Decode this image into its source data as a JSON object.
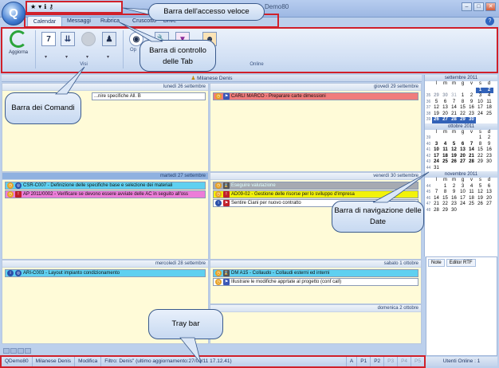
{
  "window": {
    "title_fragment": "Demo80"
  },
  "quick_access": {
    "icons": [
      "star-icon",
      "info-icon",
      "key-icon"
    ]
  },
  "tabs": [
    {
      "label": "Calendar",
      "active": true
    },
    {
      "label": "Messaggi"
    },
    {
      "label": "Rubrica"
    },
    {
      "label": "Cruscotto"
    },
    {
      "label": "Drive"
    }
  ],
  "ribbon": {
    "refresh_label": "Aggiorna",
    "group_online": "Online",
    "group_vis_fragment": "Visi",
    "group_op_fragment": "Op"
  },
  "owner_header": "Milanese Denis",
  "days": [
    {
      "label": "lunedì 26 settembre",
      "events": [
        {
          "text": "...nire specifiche All. B",
          "color": "#ffffff"
        }
      ]
    },
    {
      "label": "giovedì 29 settembre",
      "events": [
        {
          "text": "CARLI MARCO - Preparare carte dimessioni",
          "color": "#f07c7c"
        }
      ]
    },
    {
      "label": "martedì 27 settembre",
      "events": [
        {
          "text": "CSR-C007 - Definizione delle specifiche base e selezione dei materiali",
          "color": "#5fd0f0"
        },
        {
          "text": "AP 2011/0002 - Verificare se devono essere avviate delle AC in seguito all'oss",
          "color": "#ec7dd8"
        }
      ]
    },
    {
      "label": "venerdì 30 settembre",
      "events": [
        {
          "text": "Eseguire valutazione",
          "color": "#a6aab2"
        },
        {
          "text": "AD09-02 - Gestione delle risorse per lo sviluppo d'impresa",
          "color": "#f2f20a"
        },
        {
          "text": "Sentire Ciani per nuovo contratto",
          "color": "#ffffff"
        }
      ]
    },
    {
      "label": "mercoledì 28 settembre",
      "events": [
        {
          "text": "ARI-C003 - Layout impianto condizionamento",
          "color": "#5fd0f0"
        }
      ]
    },
    {
      "label": "sabato 1 ottobre",
      "events": [
        {
          "text": "DM A15 - Collaudo - Collaudi esterni ed interni",
          "color": "#5fd0f0"
        },
        {
          "text": "Illustrare le modifiche apprtate al progetto (conf call)",
          "color": "#ffffff"
        }
      ]
    },
    {
      "label": "domenica 2 ottobre",
      "events": []
    }
  ],
  "calendars": [
    {
      "title": "settembre 2011",
      "weekdays": [
        "l",
        "m",
        "m",
        "g",
        "v",
        "s",
        "d"
      ],
      "rows": [
        {
          "wk": "",
          "days": [
            "",
            "",
            "",
            "",
            "",
            "1",
            "2"
          ]
        },
        {
          "wk": "35",
          "days": [
            "29",
            "30",
            "31",
            "1",
            "2",
            "3",
            "4"
          ]
        },
        {
          "wk": "36",
          "days": [
            "5",
            "6",
            "7",
            "8",
            "9",
            "10",
            "11"
          ]
        },
        {
          "wk": "37",
          "days": [
            "12",
            "13",
            "14",
            "15",
            "16",
            "17",
            "18"
          ]
        },
        {
          "wk": "38",
          "days": [
            "19",
            "20",
            "21",
            "22",
            "23",
            "24",
            "25"
          ]
        },
        {
          "wk": "39",
          "days": [
            "26",
            "27",
            "28",
            "29",
            "30",
            "",
            ""
          ]
        }
      ]
    },
    {
      "title": "ottobre 2011",
      "weekdays": [
        "l",
        "m",
        "m",
        "g",
        "v",
        "s",
        "d"
      ],
      "rows": [
        {
          "wk": "39",
          "days": [
            "",
            "",
            "",
            "",
            "",
            "1",
            "2"
          ]
        },
        {
          "wk": "40",
          "days": [
            "3",
            "4",
            "5",
            "6",
            "7",
            "8",
            "9"
          ]
        },
        {
          "wk": "41",
          "days": [
            "10",
            "11",
            "12",
            "13",
            "14",
            "15",
            "16"
          ]
        },
        {
          "wk": "42",
          "days": [
            "17",
            "18",
            "19",
            "20",
            "21",
            "22",
            "23"
          ]
        },
        {
          "wk": "43",
          "days": [
            "24",
            "25",
            "26",
            "27",
            "28",
            "29",
            "30"
          ]
        },
        {
          "wk": "44",
          "days": [
            "31",
            "",
            "",
            "",
            "",
            "",
            ""
          ]
        }
      ]
    },
    {
      "title": "novembre 2011",
      "weekdays": [
        "l",
        "m",
        "m",
        "g",
        "v",
        "s",
        "d"
      ],
      "rows": [
        {
          "wk": "44",
          "days": [
            "",
            "1",
            "2",
            "3",
            "4",
            "5",
            "6"
          ]
        },
        {
          "wk": "45",
          "days": [
            "7",
            "8",
            "9",
            "10",
            "11",
            "12",
            "13"
          ]
        },
        {
          "wk": "46",
          "days": [
            "14",
            "15",
            "16",
            "17",
            "18",
            "19",
            "20"
          ]
        },
        {
          "wk": "47",
          "days": [
            "21",
            "22",
            "23",
            "24",
            "25",
            "26",
            "27"
          ]
        },
        {
          "wk": "48",
          "days": [
            "28",
            "29",
            "30",
            "",
            "",
            "",
            ""
          ]
        }
      ]
    }
  ],
  "notes": {
    "tab_notes": "Note",
    "tab_editor": "Editor RTF"
  },
  "users_online": "Utenti Online : 1",
  "tray": {
    "app": "QDemo80",
    "user": "Milanese Denis",
    "mode": "Modifica",
    "filter": "Filtro: Denis\" (ultimo aggiornamento:27/09/11 17.12.41)",
    "priorities": [
      "A",
      "P1",
      "P2",
      "P3",
      "P4",
      "P5"
    ]
  },
  "callouts": {
    "qat": "Barra dell'accesso veloce",
    "tabs": "Barra di controllo delle Tab",
    "commands": "Barra dei Comandi",
    "datenav": "Barra di navigazione delle Date",
    "tray": "Tray bar"
  }
}
